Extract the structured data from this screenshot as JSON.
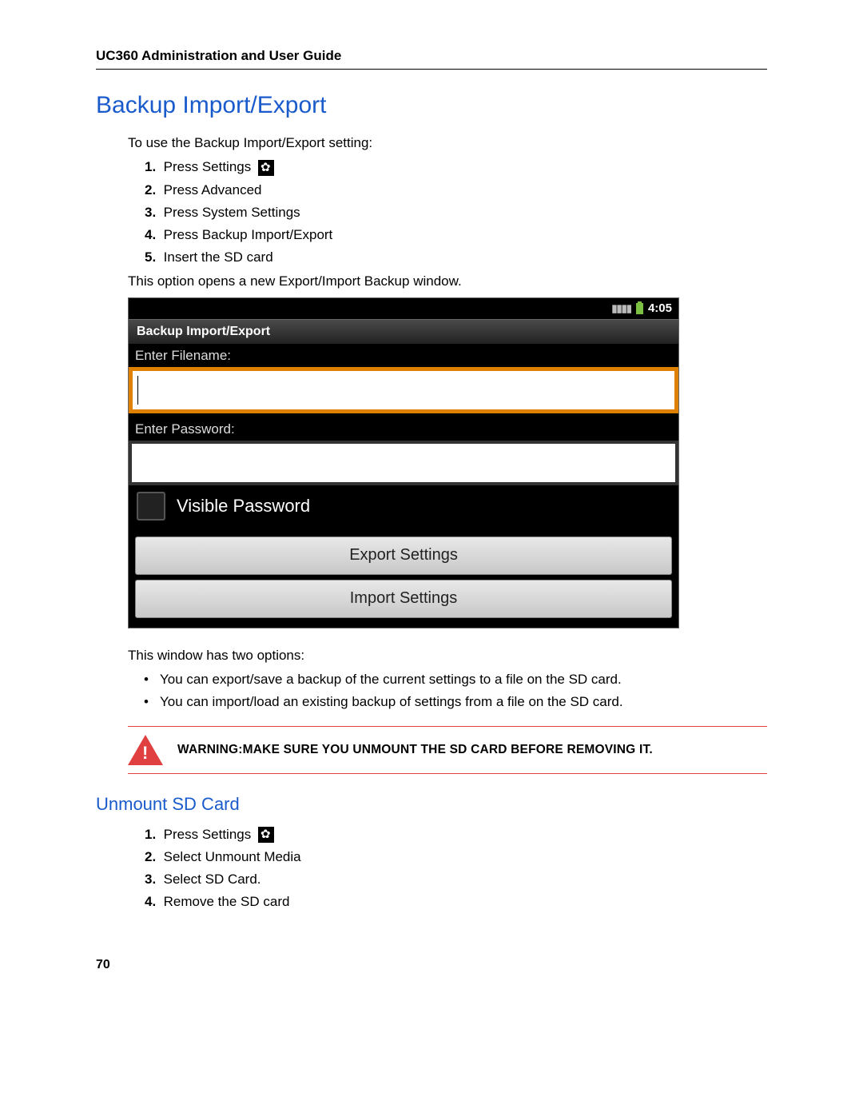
{
  "header": {
    "title": "UC360 Administration and User Guide"
  },
  "section1": {
    "title": "Backup Import/Export",
    "intro": "To use the Backup Import/Export setting:",
    "steps": [
      "Press Settings",
      "Press Advanced",
      "Press System Settings",
      "Press Backup Import/Export",
      "Insert the SD card"
    ],
    "after_steps": "This option opens a new Export/Import Backup window."
  },
  "screenshot": {
    "time": "4:05",
    "title": "Backup Import/Export",
    "filename_label": "Enter Filename:",
    "password_label": "Enter Password:",
    "visible_password": "Visible Password",
    "export_btn": "Export Settings",
    "import_btn": "Import Settings"
  },
  "after_screenshot": {
    "intro": "This window has two options:",
    "bullets": [
      "You can export/save a backup of the current settings to a file on the SD card.",
      "You can import/load an existing backup of settings from a file on the SD card."
    ]
  },
  "warning": "WARNING:MAKE SURE YOU UNMOUNT THE SD CARD BEFORE REMOVING IT.",
  "section2": {
    "title": "Unmount SD Card",
    "steps": [
      "Press Settings",
      "Select Unmount Media",
      "Select SD Card.",
      "Remove the SD card"
    ]
  },
  "page_number": "70"
}
